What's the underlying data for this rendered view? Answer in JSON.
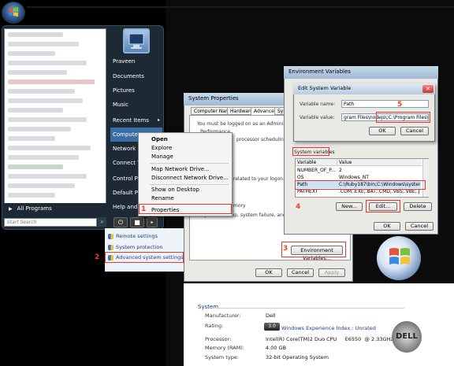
{
  "start_menu": {
    "right_items": [
      {
        "label": "Praveen",
        "arrow": ""
      },
      {
        "label": "Documents",
        "arrow": ""
      },
      {
        "label": "Pictures",
        "arrow": ""
      },
      {
        "label": "Music",
        "arrow": ""
      },
      {
        "label": "Recent Items",
        "arrow": "▸"
      },
      {
        "label": "Computer",
        "arrow": ""
      },
      {
        "label": "Network",
        "arrow": ""
      },
      {
        "label": "Connect To",
        "arrow": ""
      },
      {
        "label": "Control Pa",
        "arrow": ""
      },
      {
        "label": "Default Pro",
        "arrow": ""
      },
      {
        "label": "Help and S",
        "arrow": ""
      }
    ],
    "all_programs": "All Programs",
    "search_placeholder": "Start Search",
    "all_programs_arrow": "▶"
  },
  "context_menu": {
    "items": [
      "Open",
      "Explore",
      "Manage",
      "Map Network Drive...",
      "Disconnect Network Drive...",
      "Show on Desktop",
      "Rename",
      "Properties"
    ]
  },
  "side_links": [
    "Remote settings",
    "System protection",
    "Advanced system settings"
  ],
  "system_properties": {
    "title": "System Properties",
    "tabs": [
      "Computer Name",
      "Hardware",
      "Advanced",
      "Syst"
    ],
    "text_admin": "You must be logged on as an Administrator to",
    "text_perf": "Performance",
    "text_sched": "processor scheduling, memor",
    "text_logon": "related to your logon",
    "text_mory": "mory",
    "text_startup": "system startup, system failure, and debugge",
    "btn_env": "Environment Variables...",
    "btn_ok": "OK",
    "btn_cancel": "Cancel",
    "btn_apply": "Apply"
  },
  "env_vars": {
    "title": "Environment Variables",
    "system_variables_label": "System variables",
    "columns": [
      "Variable",
      "Value"
    ],
    "rows": [
      {
        "var": "NUMBER_OF_P...",
        "val": "2"
      },
      {
        "var": "OS",
        "val": "Windows_NT"
      },
      {
        "var": "Path",
        "val": "C:\\Ruby187\\bin;C:\\Windows\\system32;..."
      },
      {
        "var": "PATHEXT",
        "val": ".COM;.EXE;.BAT;.CMD;.VBS;.VBE;.JS;..."
      }
    ],
    "btn_new": "New...",
    "btn_edit": "Edit...",
    "btn_delete": "Delete",
    "btn_ok": "OK",
    "btn_cancel": "Cancel"
  },
  "edit_var": {
    "title": "Edit System Variable",
    "name_label": "Variable name:",
    "name_value": "Path",
    "value_label": "Variable value:",
    "value_value": "gram Files\\nodejs\\;C:\\Program Files\\Git\\bin",
    "btn_ok": "OK",
    "btn_cancel": "Cancel"
  },
  "steps": [
    "1",
    "2",
    "3",
    "4",
    "5"
  ],
  "system_info": {
    "heading": "System",
    "manufacturer_label": "Manufacturer:",
    "manufacturer": "Dell",
    "rating_label": "Rating:",
    "rating_badge": "3.0",
    "rating_link": "Windows Experience Index : Unrated",
    "processor_label": "Processor:",
    "processor": "Intel(R) Core(TM)2 Duo CPU     E6550  @ 2.33GHz   2.33 GHz",
    "memory_label": "Memory (RAM):",
    "memory": "4.00 GB",
    "systype_label": "System type:",
    "systype": "32-bit Operating System",
    "dell_logo": "DELL"
  }
}
